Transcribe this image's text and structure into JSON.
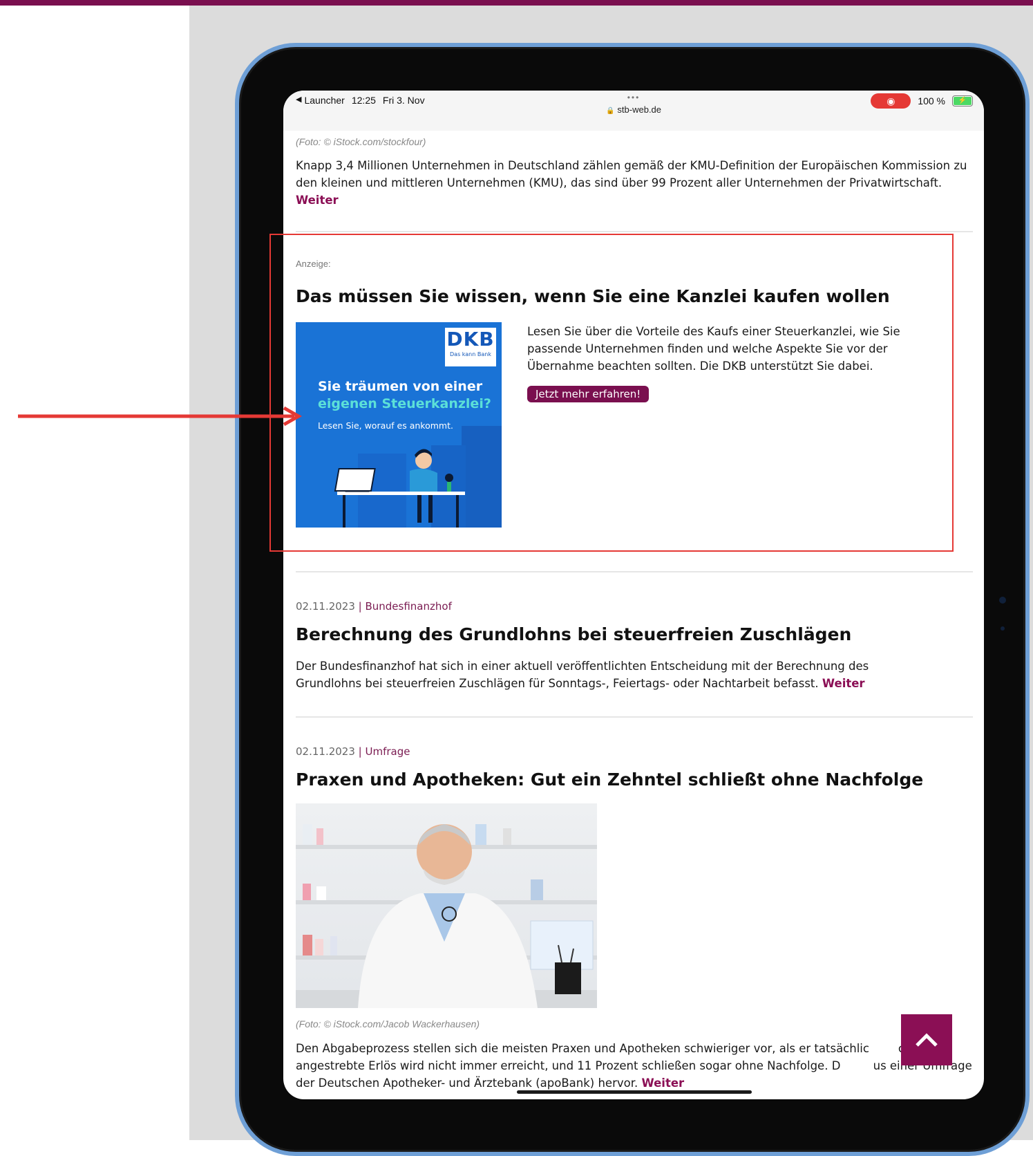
{
  "status_bar": {
    "back_label": "Launcher",
    "time": "12:25",
    "date": "Fri 3. Nov",
    "dots": "•••",
    "url": "stb-web.de",
    "battery_percent": "100 %"
  },
  "article_prev": {
    "caption": "(Foto: © iStock.com/stockfour)",
    "text": "Knapp 3,4 Millionen Unternehmen in Deutschland zählen gemäß der KMU-Definition der Europäischen Kommission zu den kleinen und mittleren Unternehmen (KMU), das sind über 99 Prozent aller Unternehmen der Privatwirtschaft.",
    "more": "Weiter"
  },
  "ad": {
    "label": "Anzeige:",
    "title": "Das müssen Sie wissen, wenn Sie eine Kanzlei kaufen wollen",
    "text": "Lesen Sie über die Vorteile des Kaufs einer Steuerkanzlei, wie Sie passende Unternehmen finden und welche Aspekte Sie vor der Übernahme beachten sollten. Die DKB unterstützt Sie dabei.",
    "cta": "Jetzt mehr erfahren!",
    "image": {
      "logo": "DKB",
      "logo_sub": "Das kann Bank",
      "line1": "Sie träumen von einer",
      "line2": "eigenen Steuerkanzlei?",
      "line3": "Lesen Sie, worauf es ankommt."
    }
  },
  "article1": {
    "date": "02.11.2023",
    "category": "Bundesfinanzhof",
    "title": "Berechnung des Grundlohns bei steuerfreien Zuschlägen",
    "text": "Der Bundesfinanzhof hat sich in einer aktuell veröffentlichten Entscheidung mit der Berechnung des Grundlohns bei steuerfreien Zuschlägen für Sonntags-, Feiertags- oder Nachtarbeit befasst.",
    "more": "Weiter"
  },
  "article2": {
    "date": "02.11.2023",
    "category": "Umfrage",
    "title": "Praxen und Apotheken: Gut ein Zehntel schließt ohne Nachfolge",
    "caption": "(Foto: © iStock.com/Jacob Wackerhausen)",
    "text": "Den Abgabeprozess stellen sich die meisten Praxen und Apotheken schwieriger vor, als er tatsächlic        ch der angestrebte Erlös wird nicht immer erreicht, und 11 Prozent schließen sogar ohne Nachfolge. D         us einer Umfrage der Deutschen Apotheker- und Ärztebank (apoBank) hervor.",
    "more": "Weiter"
  },
  "colors": {
    "brand": "#7a0f4f",
    "highlight": "#e53935",
    "ad_blue": "#1a73d6"
  }
}
